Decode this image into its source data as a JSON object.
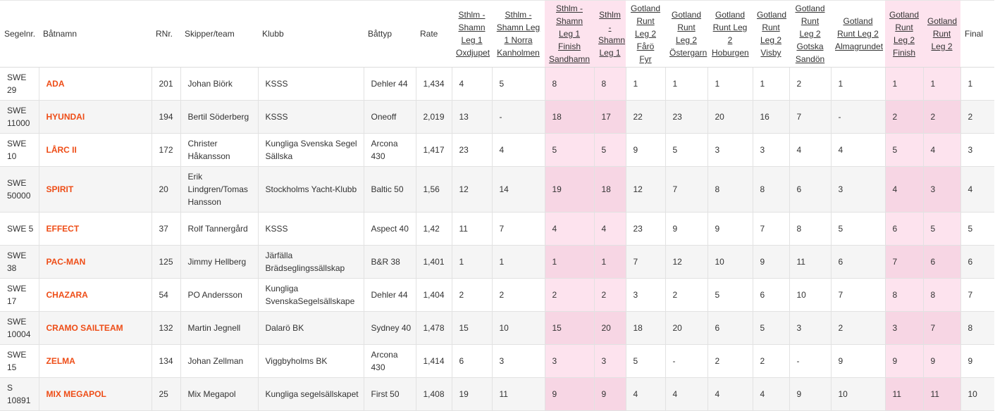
{
  "columns": {
    "segelnr": "Segelnr.",
    "batnamn": "Båtnamn",
    "rnr": "RNr.",
    "skipper": "Skipper/team",
    "klubb": "Klubb",
    "battyp": "Båttyp",
    "rate": "Rate",
    "c1": "Sthlm - Shamn Leg 1 Oxdjupet",
    "c2": "Sthlm - Shamn Leg 1 Norra Kanholmen",
    "c3": "Sthlm - Shamn Leg 1 Finish Sandhamn",
    "c4": "Sthlm - Shamn Leg 1",
    "c5": "Gotland Runt Leg 2 Fårö Fyr",
    "c6": "Gotland Runt Leg 2 Östergarn",
    "c7": "Gotland Runt Leg 2 Hoburgen",
    "c8": "Gotland Runt Leg 2 Visby",
    "c9": "Gotland Runt Leg 2 Gotska Sandön",
    "c10": "Gotland Runt Leg 2 Almagrundet",
    "c11": "Gotland Runt Leg 2 Finish",
    "c12": "Gotland Runt Leg 2",
    "final": "Final"
  },
  "rows": [
    {
      "segelnr": "SWE 29",
      "name": "ADA",
      "rnr": "201",
      "skipper": "Johan Biörk",
      "klubb": "KSSS",
      "battyp": "Dehler 44",
      "rate": "1,434",
      "c": [
        "4",
        "5",
        "8",
        "8",
        "1",
        "1",
        "1",
        "1",
        "2",
        "1",
        "1",
        "1"
      ],
      "final": "1"
    },
    {
      "segelnr": "SWE 11000",
      "name": "HYUNDAI",
      "rnr": "194",
      "skipper": "Bertil Söderberg",
      "klubb": "KSSS",
      "battyp": "Oneoff",
      "rate": "2,019",
      "c": [
        "13",
        "-",
        "18",
        "17",
        "22",
        "23",
        "20",
        "16",
        "7",
        "-",
        "2",
        "2"
      ],
      "final": "2"
    },
    {
      "segelnr": "SWE 10",
      "name": "LÅRC II",
      "rnr": "172",
      "skipper": "Christer Håkansson",
      "klubb": "Kungliga Svenska Segel Sällska",
      "battyp": "Arcona 430",
      "rate": "1,417",
      "c": [
        "23",
        "4",
        "5",
        "5",
        "9",
        "5",
        "3",
        "3",
        "4",
        "4",
        "5",
        "4"
      ],
      "final": "3"
    },
    {
      "segelnr": "SWE 50000",
      "name": "SPIRIT",
      "rnr": "20",
      "skipper": "Erik Lindgren/Tomas Hansson",
      "klubb": "Stockholms Yacht-Klubb",
      "battyp": "Baltic 50",
      "rate": "1,56",
      "c": [
        "12",
        "14",
        "19",
        "18",
        "12",
        "7",
        "8",
        "8",
        "6",
        "3",
        "4",
        "3"
      ],
      "final": "4"
    },
    {
      "segelnr": "SWE 5",
      "name": "EFFECT",
      "rnr": "37",
      "skipper": "Rolf Tannergård",
      "klubb": "KSSS",
      "battyp": "Aspect 40",
      "rate": "1,42",
      "c": [
        "11",
        "7",
        "4",
        "4",
        "23",
        "9",
        "9",
        "7",
        "8",
        "5",
        "6",
        "5"
      ],
      "final": "5"
    },
    {
      "segelnr": "SWE 38",
      "name": "PAC-MAN",
      "rnr": "125",
      "skipper": "Jimmy Hellberg",
      "klubb": "Järfälla Brädseglingssällskap",
      "battyp": "B&R 38",
      "rate": "1,401",
      "c": [
        "1",
        "1",
        "1",
        "1",
        "7",
        "12",
        "10",
        "9",
        "11",
        "6",
        "7",
        "6"
      ],
      "final": "6"
    },
    {
      "segelnr": "SWE 17",
      "name": "CHAZARA",
      "rnr": "54",
      "skipper": "PO Andersson",
      "klubb": "Kungliga SvenskaSegelsällskape",
      "battyp": "Dehler 44",
      "rate": "1,404",
      "c": [
        "2",
        "2",
        "2",
        "2",
        "3",
        "2",
        "5",
        "6",
        "10",
        "7",
        "8",
        "8"
      ],
      "final": "7"
    },
    {
      "segelnr": "SWE 10004",
      "name": "CRAMO SAILTEAM",
      "rnr": "132",
      "skipper": "Martin Jegnell",
      "klubb": "Dalarö BK",
      "battyp": "Sydney 40",
      "rate": "1,478",
      "c": [
        "15",
        "10",
        "15",
        "20",
        "18",
        "20",
        "6",
        "5",
        "3",
        "2",
        "3",
        "7"
      ],
      "final": "8"
    },
    {
      "segelnr": "SWE 15",
      "name": "ZELMA",
      "rnr": "134",
      "skipper": "Johan Zellman",
      "klubb": "Viggbyholms BK",
      "battyp": "Arcona 430",
      "rate": "1,414",
      "c": [
        "6",
        "3",
        "3",
        "3",
        "5",
        "-",
        "2",
        "2",
        "-",
        "9",
        "9",
        "9"
      ],
      "final": "9"
    },
    {
      "segelnr": "S 10891",
      "name": "MIX MEGAPOL",
      "rnr": "25",
      "skipper": "Mix Megapol",
      "klubb": "Kungliga segelsällskapet",
      "battyp": "First 50",
      "rate": "1,408",
      "c": [
        "19",
        "11",
        "9",
        "9",
        "4",
        "4",
        "4",
        "4",
        "9",
        "10",
        "11",
        "11"
      ],
      "final": "10"
    }
  ]
}
